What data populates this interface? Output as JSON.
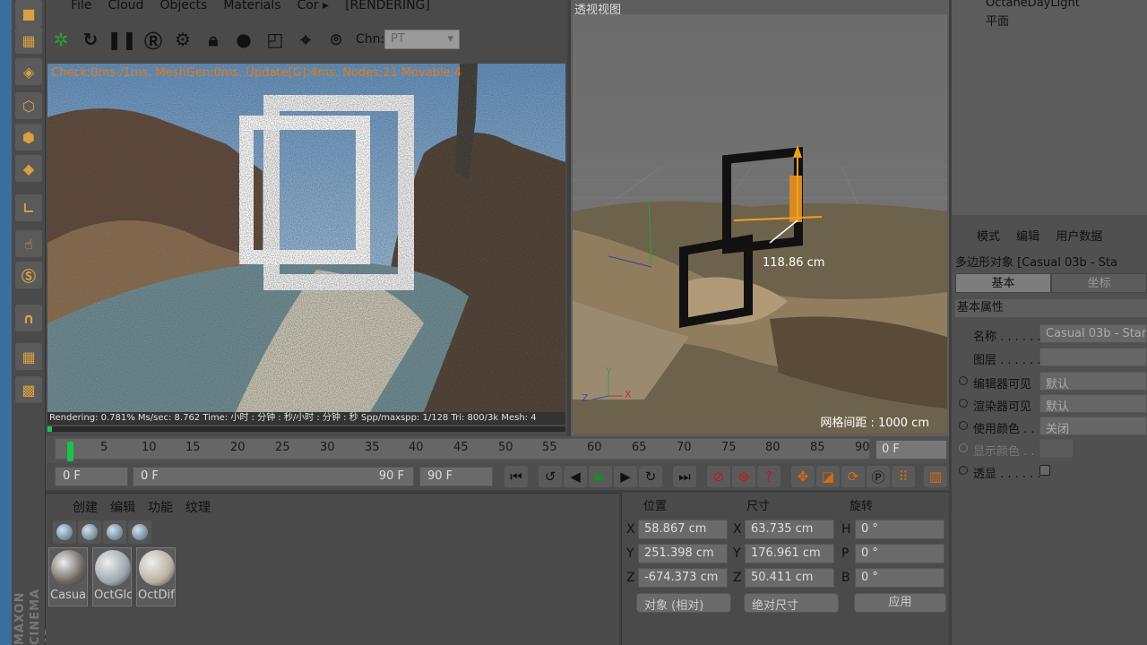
{
  "render_view": {
    "menu": [
      "File",
      "Cloud",
      "Objects",
      "Materials",
      "Cor ▸",
      "[RENDERING]"
    ],
    "channel_label": "Chn:",
    "channel_value": "PT",
    "stats": "Check:0ms./1ms. MeshGen:0ms. Update[G]:4ms. Nodes:21 Movable:4",
    "status_bar": "Rendering: 0.781% Ms/sec: 8.762    Time: 小时 : 分钟 : 秒/小时 : 分钟 : 秒   Spp/maxspp: 1/128    Tri: 800/3k    Mesh: 4",
    "progress_percent": 0.781
  },
  "viewport": {
    "title": "透视视图",
    "measurement": "118.86 cm",
    "grid_spacing": "网格间距 : 1000 cm",
    "axis_labels": {
      "x": "X",
      "y": "Y",
      "z": "Z"
    }
  },
  "timeline": {
    "ticks": [
      "0",
      "5",
      "10",
      "15",
      "20",
      "25",
      "30",
      "35",
      "40",
      "45",
      "50",
      "55",
      "60",
      "65",
      "70",
      "75",
      "80",
      "85",
      "90"
    ],
    "current_frame": "0 F"
  },
  "transport": {
    "start_frame": "0 F",
    "range_start": "0 F",
    "range_end": "90 F",
    "end_frame": "90 F"
  },
  "materials": {
    "menu": [
      "创建",
      "编辑",
      "功能",
      "纹理"
    ],
    "items": [
      {
        "name": "Casua",
        "color": "#6b645d"
      },
      {
        "name": "OctGlc",
        "color": "#9ca6ad"
      },
      {
        "name": "OctDif",
        "color": "#b8b0a0"
      }
    ]
  },
  "coordinates": {
    "headers": {
      "position": "位置",
      "size": "尺寸",
      "rotation": "旋转"
    },
    "position": [
      {
        "axis": "X",
        "value": "58.867 cm"
      },
      {
        "axis": "Y",
        "value": "251.398 cm"
      },
      {
        "axis": "Z",
        "value": "-674.373 cm"
      }
    ],
    "size": [
      {
        "axis": "X",
        "value": "63.735 cm"
      },
      {
        "axis": "Y",
        "value": "176.961 cm"
      },
      {
        "axis": "Z",
        "value": "50.411 cm"
      }
    ],
    "rotation": [
      {
        "axis": "H",
        "value": "0 °"
      },
      {
        "axis": "P",
        "value": "0 °"
      },
      {
        "axis": "B",
        "value": "0 °"
      }
    ],
    "mode_dropdown": "对象 (相对)",
    "size_dropdown": "绝对尺寸",
    "apply_label": "应用"
  },
  "objects": {
    "items": [
      "OctaneDayLight",
      "平面"
    ]
  },
  "attributes": {
    "menu": [
      "模式",
      "编辑",
      "用户数据"
    ],
    "object_title": "多边形对象 [Casual 03b - Sta",
    "tabs": [
      "基本",
      "坐标"
    ],
    "section": "基本属性",
    "rows": [
      {
        "label": "名称 . . . . . .",
        "value": "Casual 03b - Star"
      },
      {
        "label": "图层 . . . . . .",
        "value": ""
      },
      {
        "label": "编辑器可见",
        "value": "默认"
      },
      {
        "label": "渲染器可见",
        "value": "默认"
      },
      {
        "label": "使用颜色 . .",
        "value": "关闭"
      },
      {
        "label": "显示颜色 . .",
        "value": ""
      },
      {
        "label": "透显 . . . . . .",
        "value": ""
      }
    ]
  },
  "branding": "MAXON CINEMA 4D"
}
